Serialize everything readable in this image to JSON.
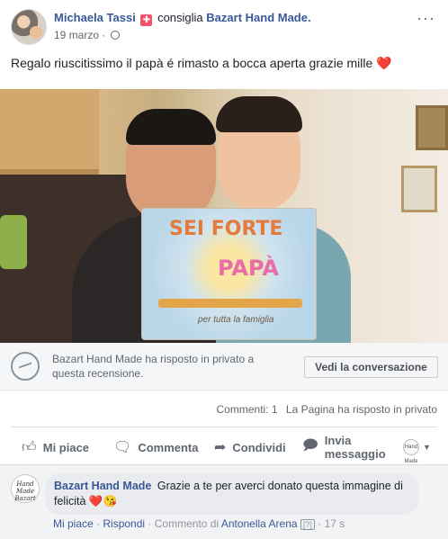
{
  "post": {
    "author": "Michaela Tassi",
    "action": "consiglia",
    "page_name": "Bazart Hand Made.",
    "date": "19 marzo",
    "separator": "·",
    "more": "···",
    "text": "Regalo riuscitissimo il papà é rimasto a bocca aperta grazie mille",
    "emoji": "❤️"
  },
  "photo": {
    "book_title_1": "SEI FORTE",
    "book_title_2": "PAPÀ",
    "book_subtitle": "per tutta la famiglia"
  },
  "reply_notice": {
    "text": "Bazart Hand Made ha risposto in privato a questa recensione.",
    "button": "Vedi la conversazione"
  },
  "counts": {
    "comments": "Commenti: 1",
    "private_reply": "La Pagina ha risposto in privato"
  },
  "actions": {
    "like": "Mi piace",
    "comment": "Commenta",
    "share": "Condividi",
    "message": "Invia messaggio",
    "page_mini": "Hand Made"
  },
  "comment": {
    "author": "Bazart Hand Made",
    "text": "Grazie a te per averci donato questa immagine di felicità",
    "emojis": "❤️😘",
    "avatar_text": "Hand Made Bazart",
    "like": "Mi piace",
    "reply": "Rispondi",
    "commented_by_prefix": "Commento di",
    "commented_by": "Antonella Arena",
    "help": "[?]",
    "time": "17 s",
    "dot": "·"
  },
  "colors": {
    "link": "#385898",
    "muted": "#606770",
    "recommend_badge": "#f35369",
    "heart": "#e0245e"
  },
  "icons": [
    "recommend-icon",
    "globe-icon",
    "more-icon",
    "messenger-icon",
    "like-icon",
    "comment-icon",
    "share-icon",
    "message-icon",
    "caret-down-icon"
  ]
}
